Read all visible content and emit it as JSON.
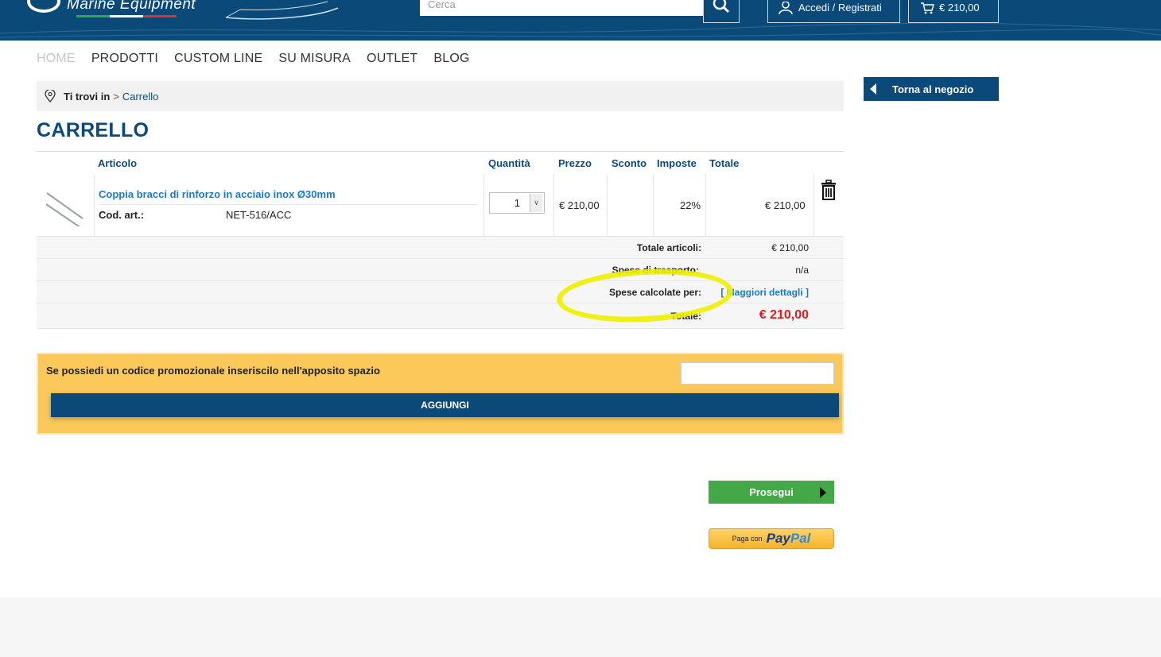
{
  "header": {
    "logo_text": "Marine Equipment",
    "search_placeholder": "Cerca",
    "login_label": "Accedi / Registrati",
    "cart_total": "€ 210,00"
  },
  "nav": {
    "items": [
      {
        "label": "HOME",
        "active": true
      },
      {
        "label": "PRODOTTI"
      },
      {
        "label": "CUSTOM LINE"
      },
      {
        "label": "SU MISURA"
      },
      {
        "label": "OUTLET"
      },
      {
        "label": "BLOG"
      }
    ]
  },
  "breadcrumb": {
    "prefix": "Ti trovi in",
    "separator": ">",
    "current": "Carrello"
  },
  "back_button": "Torna al negozio",
  "page_title": "CARRELLO",
  "table": {
    "headers": {
      "article": "Articolo",
      "quantity": "Quantità",
      "price": "Prezzo",
      "discount": "Sconto",
      "tax": "Imposte",
      "total": "Totale"
    },
    "item": {
      "name": "Coppia bracci di rinforzo in acciaio inox Ø30mm",
      "code_label": "Cod. art.:",
      "code": "NET-516/ACC",
      "quantity": "1",
      "price": "€ 210,00",
      "discount": "",
      "tax": "22%",
      "total": "€ 210,00"
    }
  },
  "summary": {
    "items_total_label": "Totale articoli:",
    "items_total_value": "€ 210,00",
    "shipping_label": "Spese di trasporto:",
    "shipping_value": "n/a",
    "calc_label": "Spese calcolate per:",
    "calc_link": "[ Maggiori dettagli ]",
    "total_label": "Totale:",
    "total_value": "€ 210,00"
  },
  "promo": {
    "label": "Se possiedi un codice promozionale inseriscilo nell'apposito spazio",
    "input_value": "",
    "button": "AGGIUNGI"
  },
  "continue_button": "Prosegui",
  "paypal": {
    "prefix": "Paga con",
    "brand_part1": "Pay",
    "brand_part2": "Pal"
  },
  "colors": {
    "brand_blue": "#0b4a78",
    "link_blue": "#1b7ac4",
    "total_red": "#e01b1b",
    "promo_bg": "#fbc95a",
    "continue_green": "#45a847",
    "highlight": "#f0f000"
  }
}
